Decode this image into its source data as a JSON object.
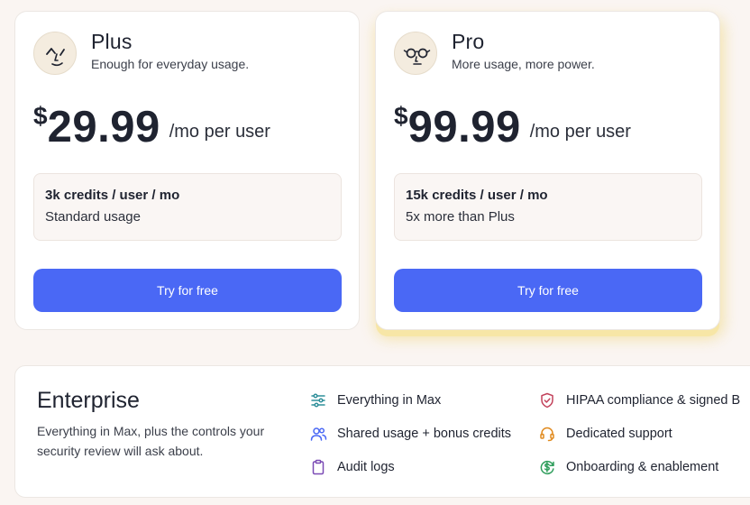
{
  "plans": [
    {
      "name": "Plus",
      "tagline": "Enough for everyday usage.",
      "currency": "$",
      "price": "29.99",
      "unit": "/mo per user",
      "credits_title": "3k credits / user / mo",
      "credits_desc": "Standard usage",
      "cta": "Try for free",
      "avatar_icon": "winking-face-icon",
      "highlighted": false
    },
    {
      "name": "Pro",
      "tagline": "More usage, more power.",
      "currency": "$",
      "price": "99.99",
      "unit": "/mo per user",
      "credits_title": "15k credits / user / mo",
      "credits_desc": "5x more than Plus",
      "cta": "Try for free",
      "avatar_icon": "glasses-face-icon",
      "highlighted": true
    }
  ],
  "enterprise": {
    "title": "Enterprise",
    "description": "Everything in Max, plus the controls your security review will ask about.",
    "features": [
      {
        "label": "Everything in Max",
        "icon": "sliders-icon"
      },
      {
        "label": "Shared usage + bonus credits",
        "icon": "users-icon"
      },
      {
        "label": "Audit logs",
        "icon": "clipboard-icon"
      },
      {
        "label": "HIPAA compliance & signed B",
        "icon": "shield-check-icon"
      },
      {
        "label": "Dedicated support",
        "icon": "headset-icon"
      },
      {
        "label": "Onboarding & enablement",
        "icon": "dollar-refresh-icon"
      }
    ]
  },
  "colors": {
    "accent": "#4a68f5",
    "background": "#faf5f2",
    "highlight_glow": "#f7e6a6",
    "icon_teal": "#2f8f9a",
    "icon_blue": "#4a68f5",
    "icon_purple": "#7b4bb5",
    "icon_red": "#c2415a",
    "icon_orange": "#e08a1e",
    "icon_green": "#2e9d5b"
  }
}
